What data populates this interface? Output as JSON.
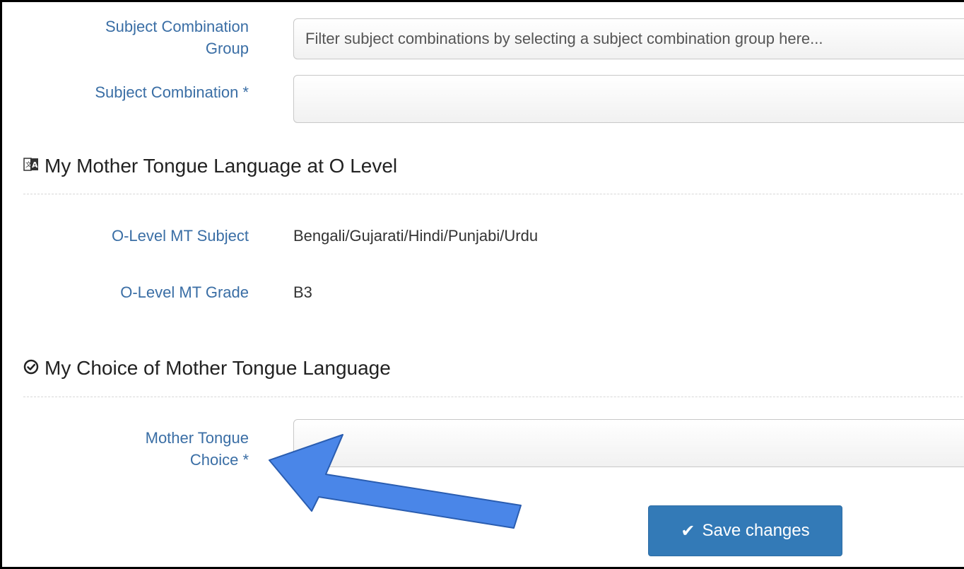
{
  "form": {
    "subject_combination_group": {
      "label": "Subject Combination Group",
      "label_line1": "Subject Combination",
      "label_line2": "Group",
      "placeholder": "Filter subject combinations by selecting a subject combination group here..."
    },
    "subject_combination": {
      "label": "Subject Combination *",
      "value": ""
    }
  },
  "section_olevel": {
    "title": "My Mother Tongue Language at O Level",
    "icon": "language-icon",
    "mt_subject_label": "O-Level MT Subject",
    "mt_subject_value": "Bengali/Gujarati/Hindi/Punjabi/Urdu",
    "mt_grade_label": "O-Level MT Grade",
    "mt_grade_value": "B3"
  },
  "section_choice": {
    "title": "My Choice of Mother Tongue Language",
    "icon": "check-circle-icon",
    "choice_label_line1": "Mother Tongue",
    "choice_label_line2": "Choice *",
    "choice_value": ""
  },
  "actions": {
    "save_label": "Save changes",
    "save_icon": "check-icon"
  },
  "colors": {
    "label_blue": "#3a6ea5",
    "button_blue": "#337ab7",
    "annotation_arrow": "#4a86e8"
  }
}
